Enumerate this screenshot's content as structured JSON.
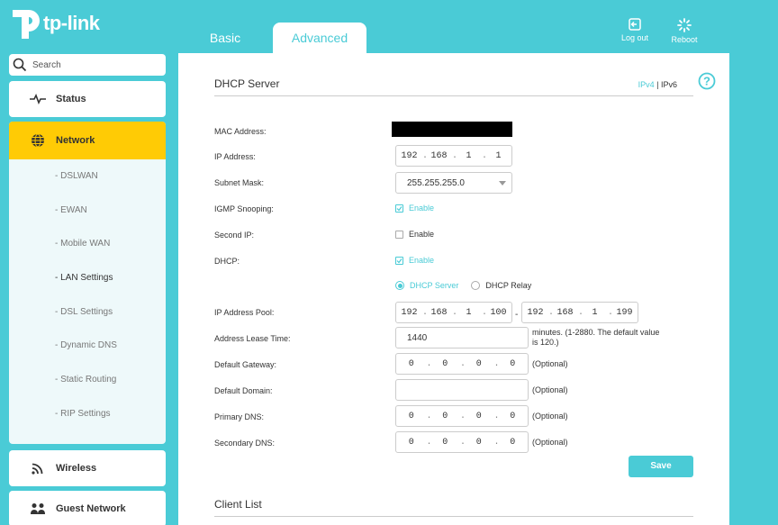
{
  "brand": {
    "name": "tp-link"
  },
  "header": {
    "tabs": [
      {
        "label": "Basic"
      },
      {
        "label": "Advanced"
      }
    ],
    "logout_label": "Log out",
    "reboot_label": "Reboot"
  },
  "sidebar": {
    "search_placeholder": "Search",
    "status_label": "Status",
    "network_label": "Network",
    "network_sub": [
      {
        "label": "- DSLWAN"
      },
      {
        "label": "- EWAN"
      },
      {
        "label": "- Mobile WAN"
      },
      {
        "label": "- LAN Settings"
      },
      {
        "label": "- DSL Settings"
      },
      {
        "label": "- Dynamic DNS"
      },
      {
        "label": "- Static Routing"
      },
      {
        "label": "- RIP Settings"
      }
    ],
    "wireless_label": "Wireless",
    "guest_label": "Guest Network"
  },
  "main": {
    "section_title": "DHCP Server",
    "ipv4_label": "IPv4",
    "separator": "|",
    "ipv6_label": "IPv6",
    "labels": {
      "mac": "MAC Address:",
      "ip": "IP Address:",
      "subnet": "Subnet Mask:",
      "igmp": "IGMP Snooping:",
      "second_ip": "Second IP:",
      "dhcp": "DHCP:",
      "pool": "IP Address Pool:",
      "lease": "Address Lease Time:",
      "gateway": "Default Gateway:",
      "domain": "Default Domain:",
      "pdns": "Primary DNS:",
      "sdns": "Secondary DNS:"
    },
    "ip_address": [
      "192",
      "168",
      "1",
      "1"
    ],
    "subnet_value": "255.255.255.0",
    "enable_label": "Enable",
    "dhcp_server_label": "DHCP Server",
    "dhcp_relay_label": "DHCP Relay",
    "pool_start": [
      "192",
      "168",
      "1",
      "100"
    ],
    "pool_dash": "-",
    "pool_end": [
      "192",
      "168",
      "1",
      "199"
    ],
    "lease_value": "1440",
    "lease_note_1": "minutes. (1-2880. The default value",
    "lease_note_2": "is 120.)",
    "gateway": [
      "0",
      "0",
      "0",
      "0"
    ],
    "pdns": [
      "0",
      "0",
      "0",
      "0"
    ],
    "sdns": [
      "0",
      "0",
      "0",
      "0"
    ],
    "optional_label": "(Optional)",
    "save_label": "Save",
    "client_list_title": "Client List"
  },
  "colors": {
    "accent": "#4acbd6",
    "active_nav": "#ffcb05"
  }
}
